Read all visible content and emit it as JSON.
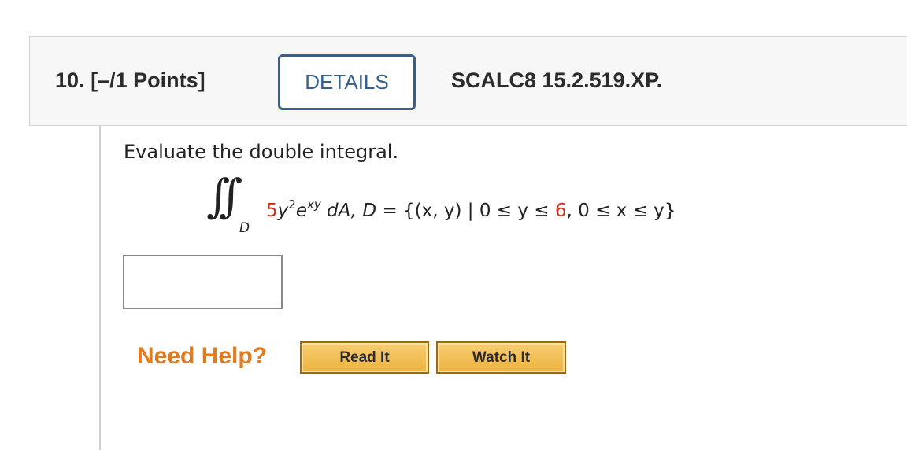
{
  "question": {
    "number": "10.",
    "points": "[–/1 Points]",
    "details_label": "DETAILS",
    "code": "SCALC8 15.2.519.XP."
  },
  "problem": {
    "prompt": "Evaluate the double integral.",
    "integral_subscript": "D",
    "coefficient": "5",
    "var_y": "y",
    "exp_2": "2",
    "base_e": "e",
    "exp_xy": "xy",
    "differential": "dA, D",
    "set_open": " = {(x, y) | 0 ≤ y ≤ ",
    "upper_bound": "6",
    "set_close": ", 0 ≤ x ≤ y}"
  },
  "answer": {
    "value": "",
    "placeholder": ""
  },
  "help": {
    "label": "Need Help?",
    "read_it": "Read It",
    "watch_it": "Watch It"
  },
  "colors": {
    "header_bg": "#f7f7f7",
    "details_accent": "#34608f",
    "highlight_red": "#d12f1f",
    "help_orange": "#e07b1f",
    "button_gold": "#eeb13f"
  },
  "icons": {
    "integral": "double-integral-symbol"
  }
}
